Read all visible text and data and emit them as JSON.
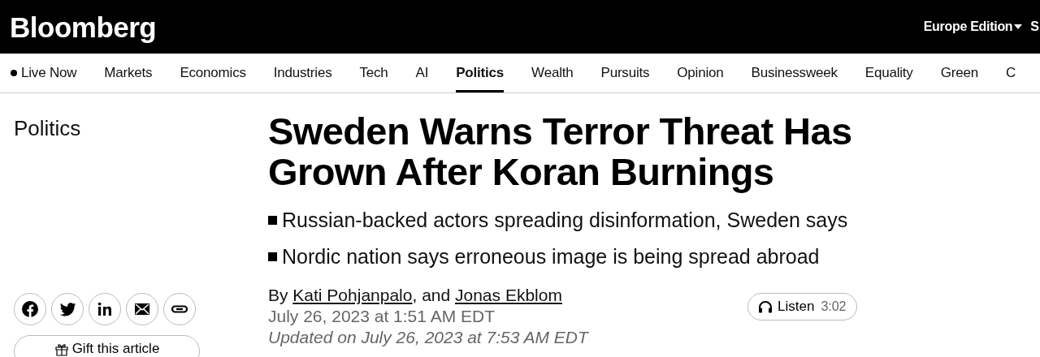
{
  "header": {
    "logo": "Bloomberg",
    "edition": "Europe Edition",
    "edge_text": "S"
  },
  "nav": [
    {
      "label": "Live Now",
      "kind": "live",
      "selected": false
    },
    {
      "label": "Markets",
      "kind": "link",
      "selected": false
    },
    {
      "label": "Economics",
      "kind": "link",
      "selected": false
    },
    {
      "label": "Industries",
      "kind": "link",
      "selected": false
    },
    {
      "label": "Tech",
      "kind": "link",
      "selected": false
    },
    {
      "label": "AI",
      "kind": "link",
      "selected": false
    },
    {
      "label": "Politics",
      "kind": "link",
      "selected": true
    },
    {
      "label": "Wealth",
      "kind": "link",
      "selected": false
    },
    {
      "label": "Pursuits",
      "kind": "link",
      "selected": false
    },
    {
      "label": "Opinion",
      "kind": "link",
      "selected": false
    },
    {
      "label": "Businessweek",
      "kind": "link",
      "selected": false
    },
    {
      "label": "Equality",
      "kind": "link",
      "selected": false
    },
    {
      "label": "Green",
      "kind": "link",
      "selected": false
    },
    {
      "label": "C",
      "kind": "link",
      "selected": false
    }
  ],
  "section": "Politics",
  "headline": "Sweden Warns Terror Threat Has Grown After Koran Burnings",
  "bullets": [
    "Russian-backed actors spreading disinformation, Sweden says",
    "Nordic nation says erroneous image is being spread abroad"
  ],
  "share": [
    {
      "kind": "facebook"
    },
    {
      "kind": "twitter"
    },
    {
      "kind": "linkedin"
    },
    {
      "kind": "email"
    },
    {
      "kind": "link"
    }
  ],
  "gift_button": "Gift this article",
  "byline": {
    "prefix": "By",
    "authors": [
      "Kati Pohjanpalo",
      "Jonas Ekblom"
    ],
    "joiner": ", and"
  },
  "published": "July 26, 2023 at 1:51 AM EDT",
  "updated": "Updated on July 26, 2023 at 7:53 AM EDT",
  "listen": {
    "label": "Listen",
    "duration": "3:02"
  }
}
